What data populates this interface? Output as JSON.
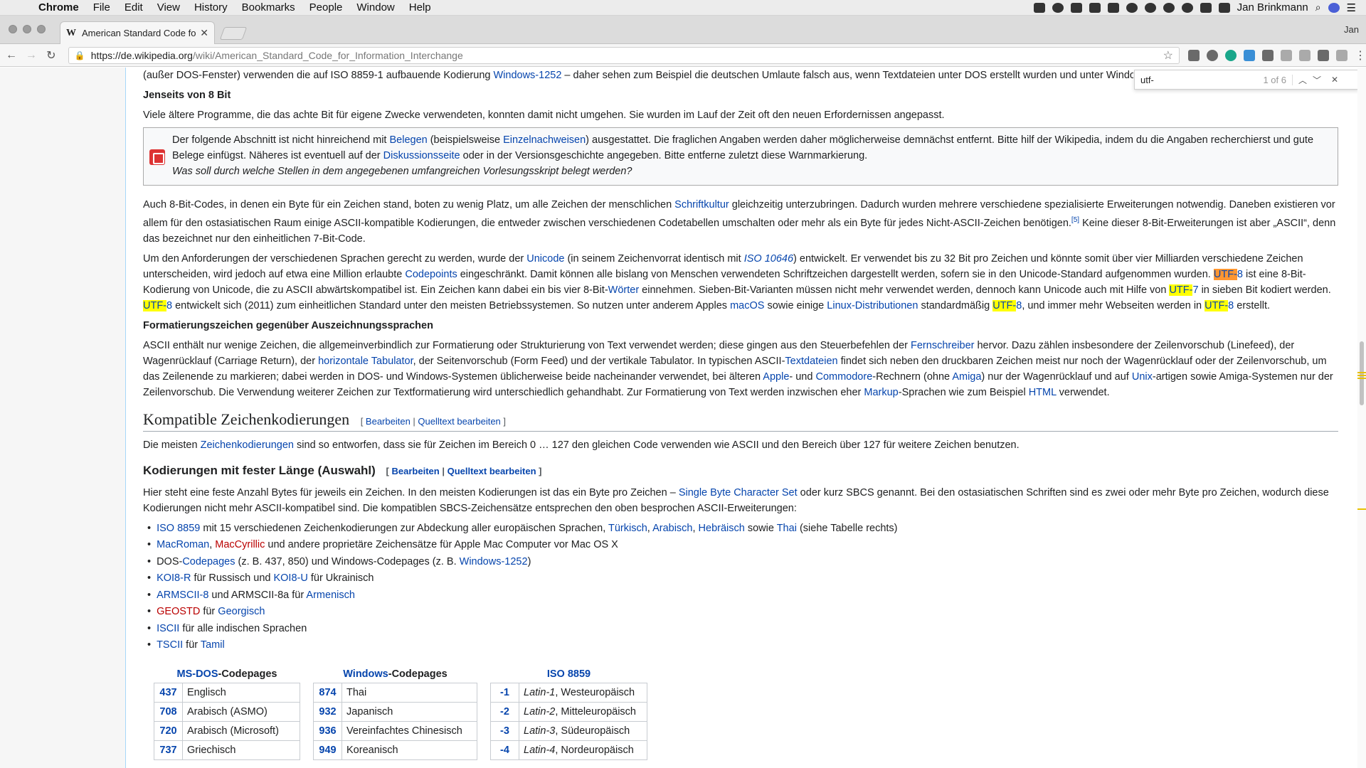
{
  "menubar": {
    "app": "Chrome",
    "items": [
      "File",
      "Edit",
      "View",
      "History",
      "Bookmarks",
      "People",
      "Window",
      "Help"
    ],
    "user": "Jan Brinkmann"
  },
  "tab": {
    "title": "American Standard Code for In",
    "profile": "Jan"
  },
  "address": {
    "host": "https://de.wikipedia.org",
    "path": "/wiki/American_Standard_Code_for_Information_Interchange"
  },
  "find": {
    "query": "utf-",
    "count": "1 of 6"
  },
  "article": {
    "p0": {
      "a": "(außer DOS-Fenster) verwenden die auf ISO 8859-1 aufbauende Kodierung ",
      "l": "Windows-1252",
      "b": " – daher sehen zum Beispiel die deutschen Umlaute falsch aus, wenn Textdateien unter DOS erstellt wurden und unter Windows betr"
    },
    "h_beyond": "Jenseits von 8 Bit",
    "p1": "Viele ältere Programme, die das achte Bit für eigene Zwecke verwendeten, konnten damit nicht umgehen. Sie wurden im Lauf der Zeit oft den neuen Erfordernissen angepasst.",
    "box": {
      "a": "Der folgende Abschnitt ist nicht hinreichend mit ",
      "l1": "Belegen",
      "b": " (beispielsweise ",
      "l2": "Einzelnachweisen",
      "c": ") ausgestattet. Die fraglichen Angaben werden daher möglicherweise demnächst entfernt. Bitte hilf der Wikipedia, indem du die Angaben recherchierst und gute Belege einfügst. Näheres ist eventuell auf der ",
      "l3": "Diskussionsseite",
      "d": " oder in der Versionsgeschichte angegeben. Bitte entferne zuletzt diese Warnmarkierung.",
      "q": "Was soll durch welche Stellen in dem angegebenen umfangreichen Vorlesungsskript belegt werden?"
    },
    "p2": {
      "a": "Auch 8-Bit-Codes, in denen ein Byte für ein Zeichen stand, boten zu wenig Platz, um alle Zeichen der menschlichen ",
      "l": "Schriftkultur",
      "b": " gleichzeitig unterzubringen. Dadurch wurden mehrere verschiedene spezialisierte Erweiterungen notwendig. Daneben existieren vor allem für den ostasiatischen Raum einige ASCII-kompatible Kodierungen, die entweder zwischen verschiedenen Codetabellen umschalten oder mehr als ein Byte für jedes Nicht-ASCII-Zeichen benötigen.",
      "ref": "[5]",
      "c": " Keine dieser 8-Bit-Erweiterungen ist aber „ASCII“, denn das bezeichnet nur den einheitlichen 7-Bit-Code."
    },
    "p3": {
      "a": "Um den Anforderungen der verschiedenen Sprachen gerecht zu werden, wurde der ",
      "l1": "Unicode",
      "b": " (in seinem Zeichenvorrat identisch mit ",
      "l2": "ISO 10646",
      "c": ") entwickelt. Er verwendet bis zu 32 Bit pro Zeichen und könnte somit über vier Milliarden verschiedene Zeichen unterscheiden, wird jedoch auf etwa eine Million erlaubte ",
      "l3": "Codepoints",
      "d": " eingeschränkt. Damit können alle bislang von Menschen verwendeten Schriftzeichen dargestellt werden, sofern sie in den Unicode-Standard aufgenommen wurden. ",
      "u1": "UTF-",
      "u1b": "8",
      "e": " ist eine 8-Bit-Kodierung von Unicode, die zu ASCII abwärtskompatibel ist. Ein Zeichen kann dabei ein bis vier 8-Bit-",
      "l4": "Wörter",
      "f": " einnehmen. Sieben-Bit-Varianten müssen nicht mehr verwendet werden, dennoch kann Unicode auch mit Hilfe von ",
      "u2": "UTF-",
      "u2b": "7",
      "g": " in sieben Bit kodiert werden. ",
      "u3": "UTF-",
      "u3b": "8",
      "h": " entwickelt sich (2011) zum einheitlichen Standard unter den meisten Betriebssystemen. So nutzen unter anderem Apples ",
      "l5": "macOS",
      "i": " sowie einige ",
      "l6": "Linux-Distributionen",
      "j": " standardmäßig ",
      "u4": "UTF-",
      "u4b": "8",
      "k": ", und immer mehr Webseiten werden in ",
      "u5": "UTF-",
      "u5b": "8",
      "m": " erstellt."
    },
    "h_format": "Formatierungszeichen gegenüber Auszeichnungssprachen",
    "p4": {
      "a": "ASCII enthält nur wenige Zeichen, die allgemeinverbindlich zur Formatierung oder Strukturierung von Text verwendet werden; diese gingen aus den Steuerbefehlen der ",
      "l1": "Fernschreiber",
      "b": " hervor. Dazu zählen insbesondere der Zeilenvorschub (Linefeed), der Wagenrücklauf (Carriage Return), der ",
      "l2": "horizontale Tabulator",
      "c": ", der Seitenvorschub (Form Feed) und der vertikale Tabulator. In typischen ASCII-",
      "l3": "Textdateien",
      "d": " findet sich neben den druckbaren Zeichen meist nur noch der Wagenrücklauf oder der Zeilenvorschub, um das Zeilenende zu markieren; dabei werden in DOS- und Windows-Systemen üblicherweise beide nacheinander verwendet, bei älteren ",
      "l4": "Apple",
      "e": "- und ",
      "l5": "Commodore",
      "f": "-Rechnern (ohne ",
      "l6": "Amiga",
      "g": ") nur der Wagenrücklauf und auf ",
      "l7": "Unix",
      "h": "-artigen sowie Amiga-Systemen nur der Zeilenvorschub. Die Verwendung weiterer Zeichen zur Textformatierung wird unterschiedlich gehandhabt. Zur Formatierung von Text werden inzwischen eher ",
      "l8": "Markup",
      "i": "-Sprachen wie zum Beispiel ",
      "l9": "HTML",
      "j": " verwendet."
    },
    "h2": "Kompatible Zeichenkodierungen",
    "edit": {
      "open": "[ ",
      "edit": "Bearbeiten",
      "sep": " | ",
      "src": "Quelltext bearbeiten",
      "close": " ]"
    },
    "p5": {
      "a": "Die meisten ",
      "l": "Zeichenkodierungen",
      "b": " sind so entworfen, dass sie für Zeichen im Bereich 0 … 127 den gleichen Code verwenden wie ASCII und den Bereich über 127 für weitere Zeichen benutzen."
    },
    "h3": "Kodierungen mit fester Länge (Auswahl)",
    "p6": {
      "a": "Hier steht eine feste Anzahl Bytes für jeweils ein Zeichen. In den meisten Kodierungen ist das ein Byte pro Zeichen – ",
      "l": "Single Byte Character Set",
      "b": " oder kurz SBCS genannt. Bei den ostasiatischen Schriften sind es zwei oder mehr Byte pro Zeichen, wodurch diese Kodierungen nicht mehr ASCII-kompatibel sind. Die kompatiblen SBCS-Zeichensätze entsprechen den oben besprochen ASCII-Erweiterungen:"
    },
    "list": [
      {
        "l1": "ISO 8859",
        "a": " mit 15 verschiedenen Zeichenkodierungen zur Abdeckung aller europäischen Sprachen, ",
        "l2": "Türkisch",
        ",": ", ",
        "l3": "Arabisch",
        "s": ", ",
        "l4": "Hebräisch",
        "b": " sowie ",
        "l5": "Thai",
        "c": " (siehe Tabelle rechts)"
      },
      {
        "l1": "MacRoman",
        "s": ", ",
        "l2": "MacCyrillic",
        "a": " und andere proprietäre Zeichensätze für Apple Mac Computer vor Mac OS X"
      },
      {
        "a": "DOS-",
        "l1": "Codepages",
        "b": " (z. B. 437, 850) und Windows-Codepages (z. B. ",
        "l2": "Windows-1252",
        "c": ")"
      },
      {
        "l1": "KOI8-R",
        "a": " für Russisch und ",
        "l2": "KOI8-U",
        "b": " für Ukrainisch"
      },
      {
        "l1": "ARMSCII-8",
        "a": " und ARMSCII-8a für ",
        "l2": "Armenisch"
      },
      {
        "l1": "GEOSTD",
        "a": " für ",
        "l2": "Georgisch"
      },
      {
        "l1": "ISCII",
        "a": " für alle indischen Sprachen"
      },
      {
        "l1": "TSCII",
        "a": " für ",
        "l2": "Tamil"
      }
    ]
  },
  "tables": {
    "msdos": {
      "cap_l": "MS-DOS",
      "cap_b": "-Codepages",
      "rows": [
        [
          "437",
          "Englisch"
        ],
        [
          "708",
          "Arabisch (ASMO)"
        ],
        [
          "720",
          "Arabisch (Microsoft)"
        ],
        [
          "737",
          "Griechisch"
        ]
      ]
    },
    "windows": {
      "cap_l": "Windows",
      "cap_b": "-Codepages",
      "rows": [
        [
          "874",
          "Thai"
        ],
        [
          "932",
          "Japanisch"
        ],
        [
          "936",
          "Vereinfachtes Chinesisch"
        ],
        [
          "949",
          "Koreanisch"
        ]
      ]
    },
    "iso": {
      "cap": "ISO 8859",
      "rows": [
        [
          "-1",
          "Latin-1",
          ", Westeuropäisch"
        ],
        [
          "-2",
          "Latin-2",
          ", Mitteleuropäisch"
        ],
        [
          "-3",
          "Latin-3",
          ", Südeuropäisch"
        ],
        [
          "-4",
          "Latin-4",
          ", Nordeuropäisch"
        ]
      ]
    }
  }
}
